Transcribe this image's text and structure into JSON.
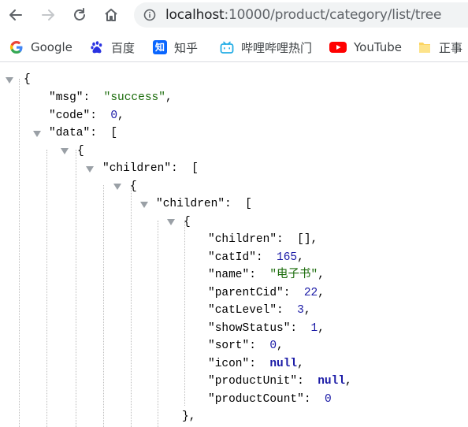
{
  "browser": {
    "url_host": "localhost",
    "url_path": ":10000/product/category/list/tree"
  },
  "bookmarks": [
    {
      "label": "Google",
      "icon": "google-icon"
    },
    {
      "label": "百度",
      "icon": "baidu-paw-icon"
    },
    {
      "label": "知乎",
      "icon": "zhihu-icon"
    },
    {
      "label": "哔哩哔哩热门",
      "icon": "bilibili-icon"
    },
    {
      "label": "YouTube",
      "icon": "youtube-icon"
    },
    {
      "label": "正事",
      "icon": "folder-icon"
    }
  ],
  "json": {
    "open_brace": "{",
    "close_brace": "}",
    "open_bracket": "[",
    "empty_array": "[]",
    "msg_key": "\"msg\"",
    "msg_value": "\"success\"",
    "code_key": "\"code\"",
    "code_value": "0",
    "data_key": "\"data\"",
    "children_key": "\"children\"",
    "catId_key": "\"catId\"",
    "catId_value": "165",
    "name_key": "\"name\"",
    "name_value": "\"电子书\"",
    "parentCid_key": "\"parentCid\"",
    "parentCid_value": "22",
    "catLevel_key": "\"catLevel\"",
    "catLevel_value": "3",
    "showStatus_key": "\"showStatus\"",
    "showStatus_value": "1",
    "sort_key": "\"sort\"",
    "sort_value": "0",
    "icon_key": "\"icon\"",
    "icon_value": "null",
    "productUnit_key": "\"productUnit\"",
    "productUnit_value": "null",
    "productCount_key": "\"productCount\"",
    "productCount_value": "0",
    "object_end": "},"
  },
  "colors": {
    "string": "#1a6b0a",
    "number": "#1a1aa6",
    "toggle": "#9aa0a6"
  }
}
